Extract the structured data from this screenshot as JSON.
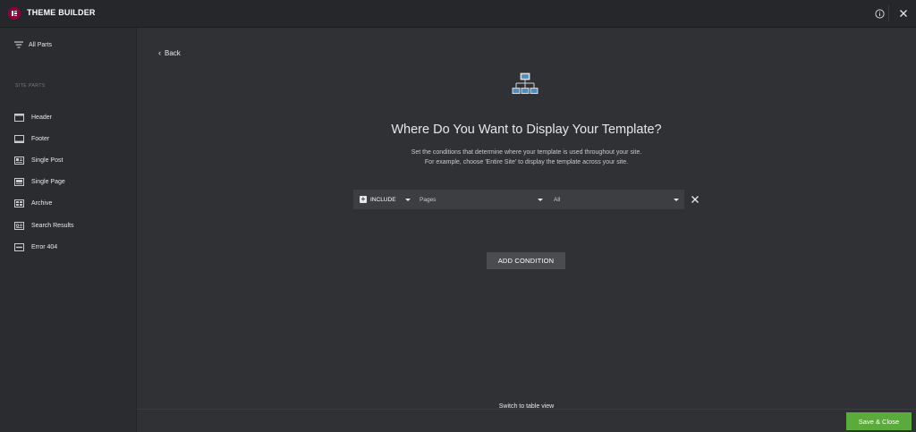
{
  "app": {
    "title": "THEME BUILDER"
  },
  "sidebar": {
    "all_parts_label": "All Parts",
    "section_label": "SITE PARTS",
    "items": [
      {
        "label": "Header",
        "icon": "header-layout-icon"
      },
      {
        "label": "Footer",
        "icon": "footer-layout-icon"
      },
      {
        "label": "Single Post",
        "icon": "single-post-icon"
      },
      {
        "label": "Single Page",
        "icon": "single-page-icon"
      },
      {
        "label": "Archive",
        "icon": "archive-icon"
      },
      {
        "label": "Search Results",
        "icon": "search-results-icon"
      },
      {
        "label": "Error 404",
        "icon": "error-404-icon"
      }
    ]
  },
  "main": {
    "back_label": "Back",
    "title": "Where Do You Want to Display Your Template?",
    "description_line1": "Set the conditions that determine where your template is used throughout your site.",
    "description_line2": "For example, choose 'Entire Site' to display the template across your site.",
    "condition": {
      "include_label": "INCLUDE",
      "type_value": "Pages",
      "scope_value": "All"
    },
    "add_condition_label": "ADD CONDITION",
    "table_view_label": "Switch to table view",
    "save_label": "Save & Close"
  },
  "colors": {
    "brand": "#92003b",
    "save_green": "#5aab3b",
    "background": "#303134"
  }
}
